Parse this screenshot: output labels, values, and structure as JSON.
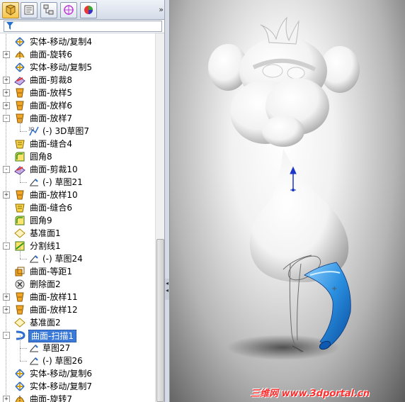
{
  "panel": {
    "tabs": [
      {
        "name": "FeatureManager",
        "icon": "feature-tree-icon",
        "active": true
      },
      {
        "name": "PropertyManager",
        "icon": "property-manager-icon",
        "active": false
      },
      {
        "name": "ConfigurationManager",
        "icon": "configuration-icon",
        "active": false
      },
      {
        "name": "DimXpert",
        "icon": "dimxpert-icon",
        "active": false
      },
      {
        "name": "Display",
        "icon": "display-manager-icon",
        "active": false
      }
    ],
    "collapse_glyph": "»"
  },
  "tree": {
    "items": [
      {
        "label": "实体-移动/复制4",
        "icon": "move-copy-icon",
        "expander": "",
        "child": false
      },
      {
        "label": "曲面-旋转6",
        "icon": "revolve-surface-icon",
        "expander": "+",
        "child": false
      },
      {
        "label": "实体-移动/复制5",
        "icon": "move-copy-icon",
        "expander": "",
        "child": false
      },
      {
        "label": "曲面-剪裁8",
        "icon": "trim-surface-icon",
        "expander": "+",
        "child": false
      },
      {
        "label": "曲面-放样5",
        "icon": "loft-surface-icon",
        "expander": "+",
        "child": false
      },
      {
        "label": "曲面-放样6",
        "icon": "loft-surface-icon",
        "expander": "+",
        "child": false
      },
      {
        "label": "曲面-放样7",
        "icon": "loft-surface-icon",
        "expander": "-",
        "child": false
      },
      {
        "label": "(-) 3D草图7",
        "icon": "3d-sketch-icon",
        "expander": "",
        "child": true
      },
      {
        "label": "曲面-缝合4",
        "icon": "knit-surface-icon",
        "expander": "",
        "child": false
      },
      {
        "label": "圆角8",
        "icon": "fillet-icon",
        "expander": "",
        "child": false
      },
      {
        "label": "曲面-剪裁10",
        "icon": "trim-surface-icon",
        "expander": "-",
        "child": false
      },
      {
        "label": "(-) 草图21",
        "icon": "sketch-icon",
        "expander": "",
        "child": true
      },
      {
        "label": "曲面-放样10",
        "icon": "loft-surface-icon",
        "expander": "+",
        "child": false
      },
      {
        "label": "曲面-缝合6",
        "icon": "knit-surface-icon",
        "expander": "",
        "child": false
      },
      {
        "label": "圆角9",
        "icon": "fillet-icon",
        "expander": "",
        "child": false
      },
      {
        "label": "基准面1",
        "icon": "plane-icon",
        "expander": "",
        "child": false
      },
      {
        "label": "分割线1",
        "icon": "split-line-icon",
        "expander": "-",
        "child": false
      },
      {
        "label": "(-) 草图24",
        "icon": "sketch-icon",
        "expander": "",
        "child": true
      },
      {
        "label": "曲面-等距1",
        "icon": "offset-surface-icon",
        "expander": "",
        "child": false
      },
      {
        "label": "删除面2",
        "icon": "delete-face-icon",
        "expander": "",
        "child": false
      },
      {
        "label": "曲面-放样11",
        "icon": "loft-surface-icon",
        "expander": "+",
        "child": false
      },
      {
        "label": "曲面-放样12",
        "icon": "loft-surface-icon",
        "expander": "+",
        "child": false
      },
      {
        "label": "基准面2",
        "icon": "plane-icon",
        "expander": "",
        "child": false
      },
      {
        "label": "曲面-扫描1",
        "icon": "sweep-surface-icon",
        "expander": "-",
        "child": false,
        "selected": true
      },
      {
        "label": "草图27",
        "icon": "sketch-icon",
        "expander": "",
        "child": true
      },
      {
        "label": "(-) 草图26",
        "icon": "sketch-icon",
        "expander": "",
        "child": true
      },
      {
        "label": "实体-移动/复制6",
        "icon": "move-copy-icon",
        "expander": "",
        "child": false
      },
      {
        "label": "实体-移动/复制7",
        "icon": "move-copy-icon",
        "expander": "",
        "child": false
      },
      {
        "label": "曲面-旋转7",
        "icon": "revolve-surface-icon",
        "expander": "+",
        "child": false
      }
    ]
  },
  "viewport": {
    "watermark": "三维网 www.3dportal.cn",
    "colors": {
      "body": "#ffffff",
      "leg": "#2a8fe0",
      "watermark": "#ff2d2d"
    }
  }
}
